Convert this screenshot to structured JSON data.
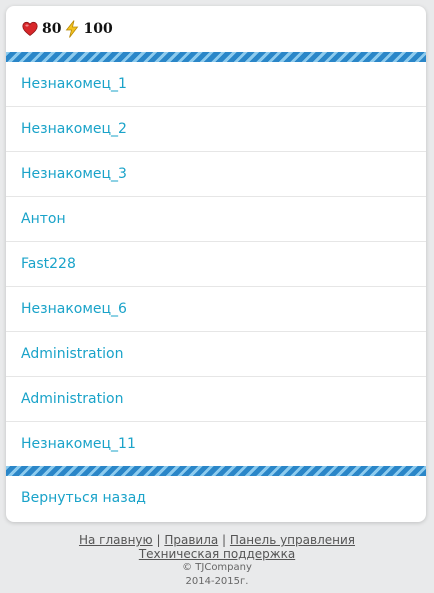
{
  "stats": {
    "health": "80",
    "energy": "100",
    "heart_color": "#d8272a",
    "bolt_color": "#f3c21e"
  },
  "players": [
    {
      "name": "Незнакомец_1"
    },
    {
      "name": "Незнакомец_2"
    },
    {
      "name": "Незнакомец_3"
    },
    {
      "name": "Антон"
    },
    {
      "name": "Fast228"
    },
    {
      "name": "Незнакомец_6"
    },
    {
      "name": "Administration"
    },
    {
      "name": "Administration"
    },
    {
      "name": "Незнакомец_11"
    }
  ],
  "back_label": "Вернуться назад",
  "footer": {
    "home": "На главную",
    "rules": "Правила",
    "panel": "Панель управления",
    "separator": "|",
    "support": "Техническая поддержка",
    "copyright": "© TJCompany",
    "years": "2014-2015г."
  },
  "colors": {
    "link": "#1aa3c9",
    "stripe_dark": "#2a86c8",
    "stripe_light": "#8dcbee",
    "background": "#e9eaeb"
  }
}
